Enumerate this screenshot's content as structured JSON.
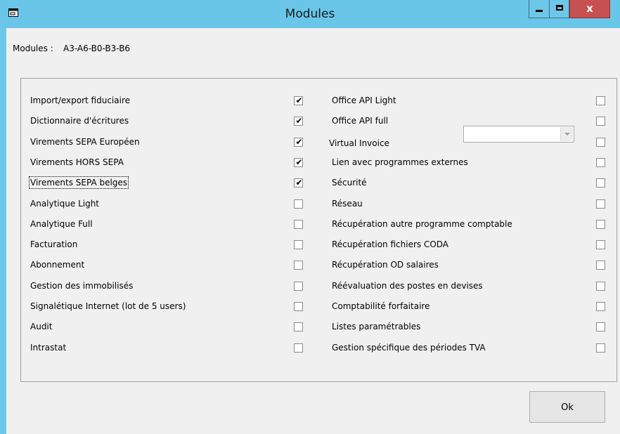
{
  "window": {
    "title": "Modules",
    "close_glyph": "x"
  },
  "header": {
    "label": "Modules :",
    "value": "A3-A6-B0-B3-B6"
  },
  "left_modules": [
    {
      "label": "Import/export fiduciaire",
      "checked": true
    },
    {
      "label": "Dictionnaire d'écritures",
      "checked": true
    },
    {
      "label": "Virements SEPA Européen",
      "checked": true
    },
    {
      "label": "Virements HORS SEPA",
      "checked": true
    },
    {
      "label": "Virements SEPA belges",
      "checked": true
    },
    {
      "label": "Analytique Light",
      "checked": false
    },
    {
      "label": "Analytique Full",
      "checked": false
    },
    {
      "label": "Facturation",
      "checked": false
    },
    {
      "label": "Abonnement",
      "checked": false
    },
    {
      "label": "Gestion des immobilisés",
      "checked": false
    },
    {
      "label": "Signalétique Internet (lot de 5 users)",
      "checked": false
    },
    {
      "label": "Audit",
      "checked": false
    },
    {
      "label": "Intrastat",
      "checked": false
    }
  ],
  "right_modules": [
    {
      "label": "Office API Light",
      "checked": false
    },
    {
      "label": "Office API full",
      "checked": false
    },
    {
      "label": "Virtual Invoice",
      "checked": false
    },
    {
      "label": "Lien avec programmes externes",
      "checked": false
    },
    {
      "label": "Sécurité",
      "checked": false
    },
    {
      "label": "Réseau",
      "checked": false
    },
    {
      "label": "Récupération autre programme comptable",
      "checked": false
    },
    {
      "label": "Récupération fichiers CODA",
      "checked": false
    },
    {
      "label": "Récupération OD salaires",
      "checked": false
    },
    {
      "label": "Réévaluation des postes en devises",
      "checked": false
    },
    {
      "label": "Comptabilité forfaitaire",
      "checked": false
    },
    {
      "label": "Listes paramétrables",
      "checked": false
    },
    {
      "label": "Gestion spécifique des périodes TVA",
      "checked": false
    }
  ],
  "virtual_invoice_combo": {
    "value": ""
  },
  "buttons": {
    "ok": "Ok"
  },
  "colors": {
    "titlebar": "#69c6e8",
    "close": "#c75050",
    "client": "#f0f0f0"
  },
  "icons": {
    "app": "window-app-icon",
    "minimize": "minimize-icon",
    "maximize": "maximize-icon",
    "close": "close-icon",
    "combo": "chevron-down-icon",
    "check": "checkmark-icon"
  }
}
